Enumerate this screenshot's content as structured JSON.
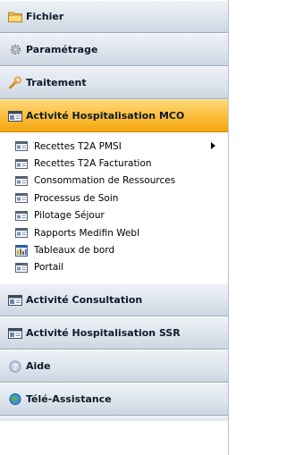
{
  "sections": {
    "fichier": "Fichier",
    "parametrage": "Paramétrage",
    "traitement": "Traitement",
    "mco": "Activité Hospitalisation MCO",
    "consultation": "Activité Consultation",
    "ssr": "Activité Hospitalisation SSR",
    "aide": "Aide",
    "teleassistance": "Télé-Assistance"
  },
  "mco_items": [
    {
      "label": "Recettes T2A PMSI",
      "icon": "report-icon",
      "has_submenu": true
    },
    {
      "label": "Recettes T2A Facturation",
      "icon": "report-icon"
    },
    {
      "label": "Consommation de Ressources",
      "icon": "report-icon"
    },
    {
      "label": "Processus de Soin",
      "icon": "report-icon"
    },
    {
      "label": "Pilotage Séjour",
      "icon": "report-icon"
    },
    {
      "label": "Rapports Medifin WebI",
      "icon": "report-icon"
    },
    {
      "label": "Tableaux de bord",
      "icon": "dashboard-icon"
    },
    {
      "label": "Portail",
      "icon": "report-icon"
    }
  ],
  "colors": {
    "active_header": "#f4a60f",
    "header": "#dde4ed"
  }
}
